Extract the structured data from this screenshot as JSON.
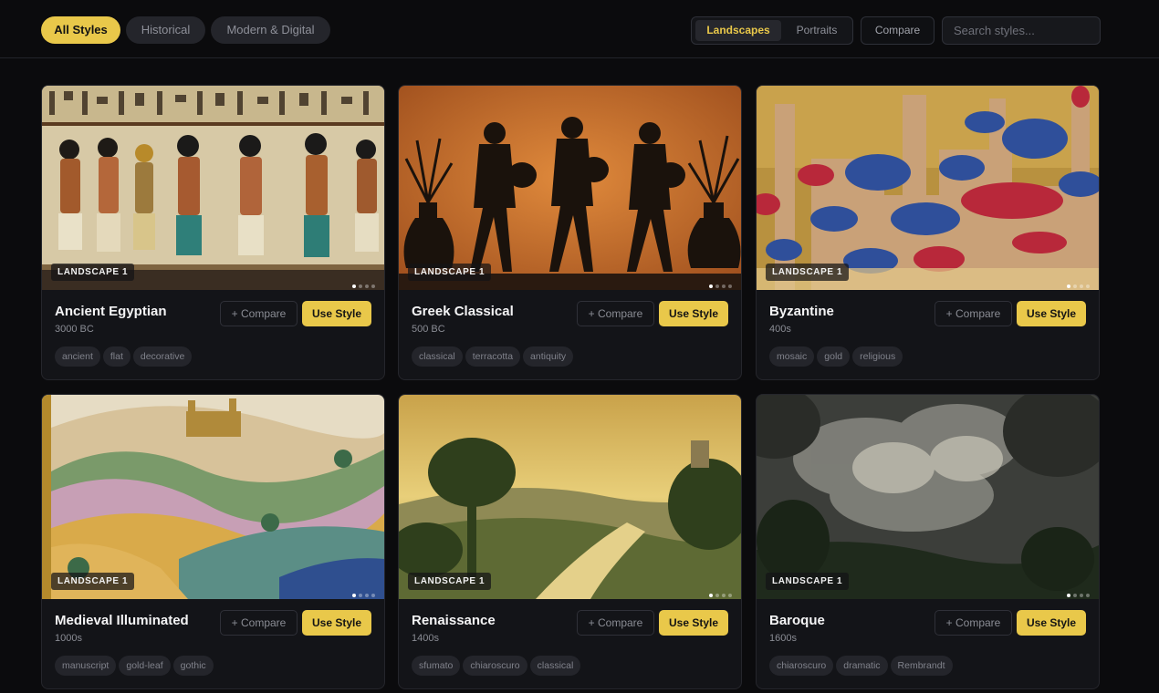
{
  "filters": {
    "all": "All Styles",
    "historical": "Historical",
    "modern": "Modern & Digital"
  },
  "view_toggle": {
    "landscapes": "Landscapes",
    "portraits": "Portraits"
  },
  "compare_label": "Compare",
  "search": {
    "placeholder": "Search styles..."
  },
  "card_compare_label": "+ Compare",
  "card_use_label": "Use Style",
  "cards": [
    {
      "title": "Ancient Egyptian",
      "era": "3000 BC",
      "badge": "LANDSCAPE 1",
      "tags": [
        "ancient",
        "flat",
        "decorative"
      ],
      "image_icon": "egyptian-mural-image"
    },
    {
      "title": "Greek Classical",
      "era": "500 BC",
      "badge": "LANDSCAPE 1",
      "tags": [
        "classical",
        "terracotta",
        "antiquity"
      ],
      "image_icon": "greek-vase-figures-image"
    },
    {
      "title": "Byzantine",
      "era": "400s",
      "badge": "LANDSCAPE 1",
      "tags": [
        "mosaic",
        "gold",
        "religious"
      ],
      "image_icon": "byzantine-domes-image"
    },
    {
      "title": "Medieval Illuminated",
      "era": "1000s",
      "badge": "LANDSCAPE 1",
      "tags": [
        "manuscript",
        "gold-leaf",
        "gothic"
      ],
      "image_icon": "illuminated-hills-image"
    },
    {
      "title": "Renaissance",
      "era": "1400s",
      "badge": "LANDSCAPE 1",
      "tags": [
        "sfumato",
        "chiaroscuro",
        "classical"
      ],
      "image_icon": "renaissance-valley-image"
    },
    {
      "title": "Baroque",
      "era": "1600s",
      "badge": "LANDSCAPE 1",
      "tags": [
        "chiaroscuro",
        "dramatic",
        "Rembrandt"
      ],
      "image_icon": "baroque-clouds-image"
    }
  ],
  "colors": {
    "accent": "#e9c84a",
    "background": "#0b0b0d",
    "card": "#131418",
    "tag": "#24252b"
  }
}
